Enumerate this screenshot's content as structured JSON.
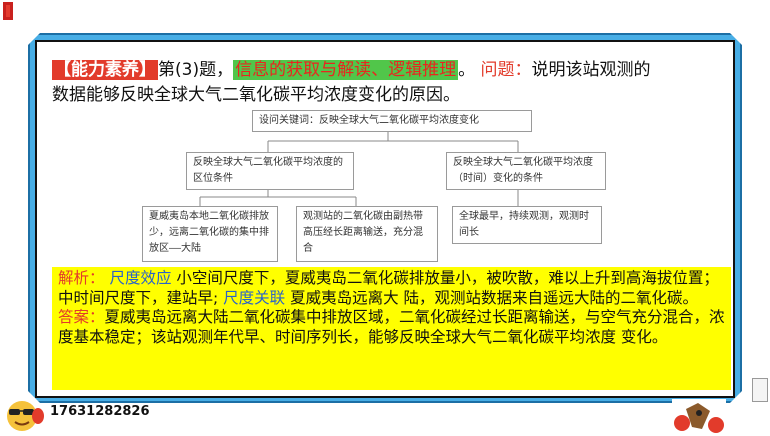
{
  "headline": {
    "ability_tag": "【能力素养】",
    "question_ref": "第(3)题，",
    "skill_tag": "信息的获取与解读、逻辑推理",
    "period": "。",
    "question_label": "问题：",
    "question_text_1": "说明该站观测的",
    "question_text_2": "数据能够反映全球大气二氧化碳平均浓度变化的原因。"
  },
  "diagram": {
    "root": "设问关键词：反映全球大气二氧化碳平均浓度变化",
    "left_mid": "反映全球大气二氧化碳平均浓度的区位条件",
    "right_mid": "反映全球大气二氧化碳平均浓度（时间）变化的条件",
    "leaf_1": "夏威夷岛本地二氧化碳排放少，远离二氧化碳的集中排放区——大陆",
    "leaf_2": "观测站的二氧化碳由副热带高压经长距离输送，充分混合",
    "leaf_3": "全球最早，持续观测，观测时间长"
  },
  "analysis": {
    "label_analysis": "解析",
    "colon1": "：",
    "scale_effect": "尺度效应",
    "text_1": "小空间尺度下，夏威夷岛二氧化碳排放量小，被吹散，难以上升到高海拔位置；中时间尺度下，建站早;",
    "scale_link": "尺度关联",
    "text_2": "夏威夷岛远离大 陆，观测站数据来自遥远大陆的二氧化碳。",
    "label_answer": "答案",
    "colon2": "：",
    "answer_text": "夏威夷岛远离大陆二氧化碳集中排放区域，二氧化碳经过长距离输送，与空气充分混合，浓度基本稳定；该站观测年代早、时间序列长，能够反映全球大气二氧化碳平均浓度 变化。"
  },
  "footer": {
    "phone": "17631282826"
  },
  "colors": {
    "frame_blue": "#48aee6",
    "highlight_yellow": "#ffff00",
    "tag_red": "#e23b2b",
    "tag_green": "#51c64a",
    "text_blue": "#2a63c9"
  }
}
